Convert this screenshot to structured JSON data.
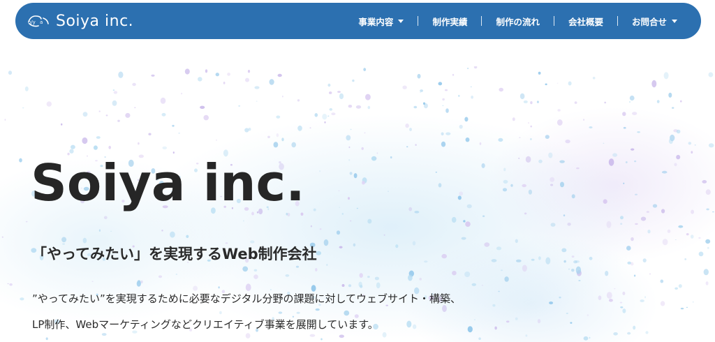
{
  "header": {
    "logo_text": "Soiya inc.",
    "bar_color": "#2c70b0"
  },
  "nav": {
    "items": [
      {
        "label": "事業内容",
        "has_dropdown": true
      },
      {
        "label": "制作実績",
        "has_dropdown": false
      },
      {
        "label": "制作の流れ",
        "has_dropdown": false
      },
      {
        "label": "会社概要",
        "has_dropdown": false
      },
      {
        "label": "お問合せ",
        "has_dropdown": true
      }
    ]
  },
  "hero": {
    "title": "Soiya inc.",
    "subtitle": "「やってみたい」を実現するWeb制作会社",
    "description_lines": [
      "”やってみたい”を実現するために必要なデジタル分野の課題に対してウェブサイト・構築、",
      "LP制作、Webマーケティングなどクリエイティブ事業を展開しています。"
    ]
  }
}
